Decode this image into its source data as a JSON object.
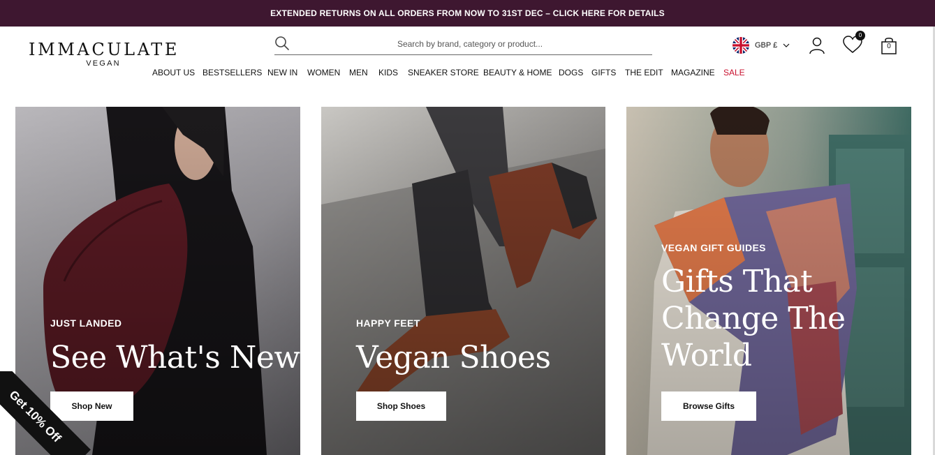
{
  "announcement": {
    "text": "EXTENDED RETURNS ON ALL ORDERS FROM NOW TO 31ST DEC – CLICK HERE FOR DETAILS"
  },
  "header": {
    "logo": {
      "brand": "IMMACULATE",
      "sub": "VEGAN"
    },
    "search": {
      "placeholder": "Search by brand, category or product..."
    },
    "currency": {
      "label": "GBP £",
      "flag": "uk-flag-icon"
    },
    "wishlist_count": "0",
    "bag_count": "0"
  },
  "nav": {
    "items": [
      "ABOUT US",
      "BESTSELLERS",
      "NEW IN",
      "WOMEN",
      "MEN",
      "KIDS",
      "SNEAKER STORE",
      "BEAUTY & HOME",
      "DOGS",
      "GIFTS",
      "THE EDIT",
      "MAGAZINE",
      "SALE"
    ],
    "sale_color": "#c8102e"
  },
  "tiles": [
    {
      "eyebrow": "JUST LANDED",
      "headline": "See What's New",
      "button": "Shop New"
    },
    {
      "eyebrow": "HAPPY FEET",
      "headline": "Vegan Shoes",
      "button": "Shop Shoes"
    },
    {
      "eyebrow": "VEGAN GIFT GUIDES",
      "headline": "Gifts That Change The World",
      "button": "Browse Gifts"
    }
  ],
  "promo_ribbon": {
    "text": "Get 10% Off"
  },
  "colors": {
    "announcement_bg": "#3e1730",
    "text": "#111111"
  }
}
